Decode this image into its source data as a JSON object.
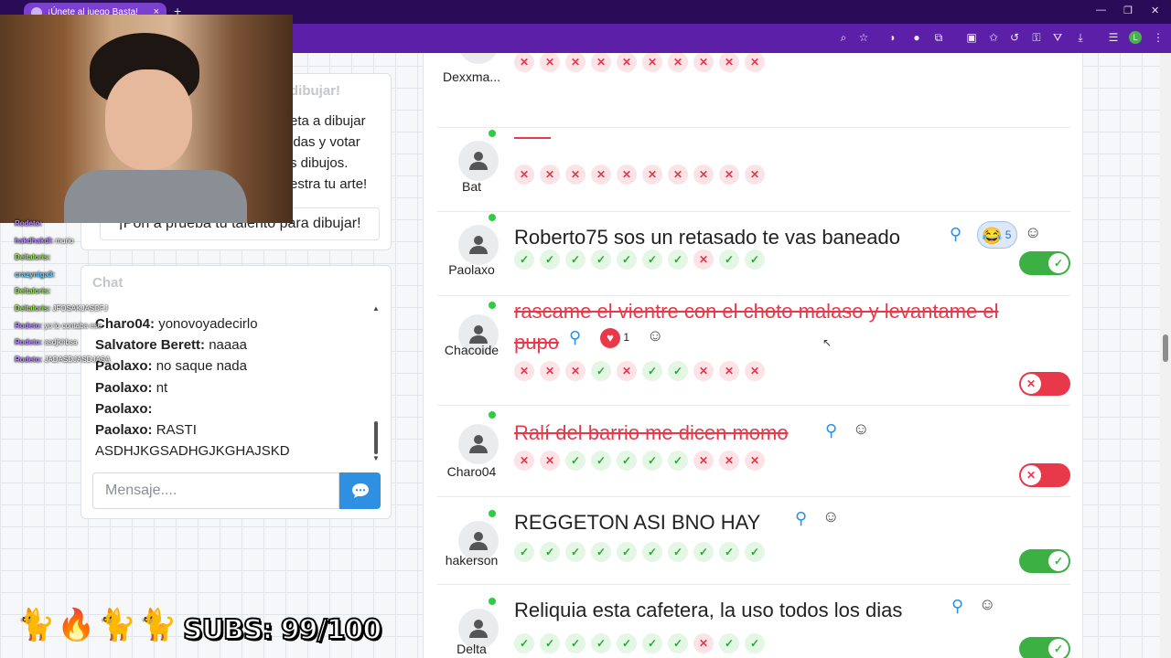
{
  "browser": {
    "tab_title": "¡Únete al juego Basta!",
    "tab_close": "×",
    "new_tab": "+",
    "window_controls": [
      "—",
      "❐",
      "✕"
    ],
    "profile_initial": "L",
    "toolbar_icons": [
      "zoom-icon",
      "star-icon",
      "media-icon",
      "extension-blue-icon",
      "puzzle-icon",
      "screenshot-icon",
      "bookmark-icon",
      "history-icon",
      "key-icon",
      "vpn-icon",
      "download-icon",
      "playlist-icon",
      "menu-icon"
    ]
  },
  "info_card": {
    "title": "dibujar!",
    "body": "eta a dibujar\nidas y votar\ns dibujos.\nestra tu arte!",
    "button": "¡Pon a prueba tu talento para dibujar!"
  },
  "chat": {
    "title": "Chat",
    "messages": [
      {
        "user": "Charo04:",
        "text": "yonovoyadecirlo"
      },
      {
        "user": "Salvatore Berett:",
        "text": "naaaa"
      },
      {
        "user": "Paolaxo:",
        "text": "no saque nada"
      },
      {
        "user": "Paolaxo:",
        "text": "nt"
      },
      {
        "user": "Paolaxo:",
        "text": ""
      },
      {
        "user": "Paolaxo:",
        "text": "RASTI ASDHJKGSADHGJKGHAJSKD"
      }
    ],
    "input_placeholder": "Mensaje....",
    "send_icon": "chat-bubble-icon"
  },
  "stream_chat": [
    {
      "user": "Rodeto:",
      "text": "",
      "color": "#b98cff"
    },
    {
      "user": "hakdhakdl:",
      "text": "murio",
      "color": "#b98cff"
    },
    {
      "user": "Deltaloris:",
      "text": "",
      "color": "#9be35a"
    },
    {
      "user": "crazyniga3:",
      "text": "",
      "color": "#6fd0ff"
    },
    {
      "user": "Deltaloris:",
      "text": "",
      "color": "#9be35a"
    },
    {
      "user": "Deltaloris:",
      "text": "JFOSAKJASDFJ",
      "color": "#9be35a"
    },
    {
      "user": "Rodeto:",
      "text": "yo lo contaba ese",
      "color": "#b98cff"
    },
    {
      "user": "Rodeto:",
      "text": "asdjkhbsa",
      "color": "#b98cff"
    },
    {
      "user": "Rodeto:",
      "text": "JADASDJASDJASA",
      "color": "#b98cff"
    }
  ],
  "overlay": {
    "cats": "🐈🔥🐈🐈",
    "subs": "SUBS: 99/100"
  },
  "answers": [
    {
      "user": "Dexxma...",
      "text": "",
      "strike": true,
      "votes": [
        "no",
        "no",
        "no",
        "no",
        "no",
        "no",
        "no",
        "no",
        "no",
        "no"
      ]
    },
    {
      "user": "Bat",
      "text": "",
      "strike": true,
      "votes": [
        "no",
        "no",
        "no",
        "no",
        "no",
        "no",
        "no",
        "no",
        "no",
        "no"
      ]
    },
    {
      "user": "Paolaxo",
      "text": "Roberto75 sos un retasado te vas baneado",
      "strike": false,
      "reaction": {
        "emoji": "😂",
        "count": "5"
      },
      "votes": [
        "ok",
        "ok",
        "ok",
        "ok",
        "ok",
        "ok",
        "ok",
        "no",
        "ok",
        "ok"
      ],
      "toggle": "on"
    },
    {
      "user": "Chacoide",
      "text_line1": "rascame el vientre con el choto malaso y levantame el",
      "text_line2": "pupo",
      "strike": true,
      "heart": {
        "count": "1"
      },
      "votes": [
        "no",
        "no",
        "no",
        "ok",
        "no",
        "ok",
        "ok",
        "no",
        "no",
        "no"
      ],
      "toggle": "off"
    },
    {
      "user": "Charo04",
      "text": "Ralí del barrio me dicen momo",
      "strike": true,
      "votes": [
        "no",
        "no",
        "ok",
        "ok",
        "ok",
        "ok",
        "ok",
        "no",
        "no",
        "no"
      ],
      "toggle": "off"
    },
    {
      "user": "hakerson",
      "text": "REGGETON ASI BNO HAY",
      "strike": false,
      "votes": [
        "ok",
        "ok",
        "ok",
        "ok",
        "ok",
        "ok",
        "ok",
        "ok",
        "ok",
        "ok"
      ],
      "toggle": "on"
    },
    {
      "user": "Delta",
      "text": "Reliquia esta cafetera, la uso todos los dias",
      "strike": false,
      "votes": [
        "ok",
        "ok",
        "ok",
        "ok",
        "ok",
        "ok",
        "ok",
        "no",
        "ok",
        "ok"
      ],
      "toggle": "on"
    }
  ],
  "colors": {
    "accent_purple": "#5b1fa8",
    "tab_purple": "#7b3fd1",
    "ok_green": "#2fa336",
    "no_red": "#e8394b",
    "send_blue": "#2f8fe0"
  }
}
